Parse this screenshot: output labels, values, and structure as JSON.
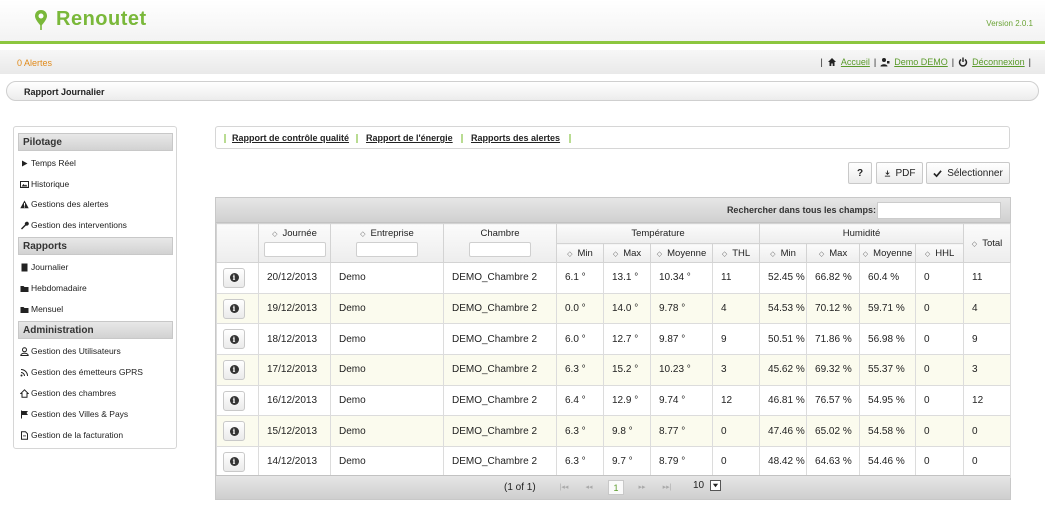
{
  "app": {
    "name": "Renoutet",
    "version": "Version 2.0.1"
  },
  "alerts": "0 Alertes",
  "topnav": {
    "home": "Accueil",
    "user": "Demo DEMO",
    "logout": "Déconnexion",
    "sep": "|"
  },
  "breadcrumb": "Rapport Journalier",
  "sidebar": {
    "sections": [
      {
        "title": "Pilotage",
        "items": [
          {
            "label": "Temps Réel",
            "icon": "play-icon"
          },
          {
            "label": "Historique",
            "icon": "image-icon"
          },
          {
            "label": "Gestions des alertes",
            "icon": "warning-icon"
          },
          {
            "label": "Gestion des interventions",
            "icon": "wrench-icon"
          }
        ]
      },
      {
        "title": "Rapports",
        "items": [
          {
            "label": "Journalier",
            "icon": "document-icon"
          },
          {
            "label": "Hebdomadaire",
            "icon": "folder-icon"
          },
          {
            "label": "Mensuel",
            "icon": "folder-icon"
          }
        ]
      },
      {
        "title": "Administration",
        "items": [
          {
            "label": "Gestion des Utilisateurs",
            "icon": "user-icon"
          },
          {
            "label": "Gestion des émetteurs GPRS",
            "icon": "signal-icon"
          },
          {
            "label": "Gestion des chambres",
            "icon": "home-icon"
          },
          {
            "label": "Gestion des Villes & Pays",
            "icon": "flag-icon"
          },
          {
            "label": "Gestion de la facturation",
            "icon": "bill-icon"
          }
        ]
      }
    ]
  },
  "tabs": [
    "Rapport de contrôle qualité",
    "Rapport de l'énergie",
    "Rapports des alertes"
  ],
  "buttons": {
    "help": "?",
    "pdf": "PDF",
    "select": "Sélectionner"
  },
  "search_label": "Rechercher dans tous les champs:",
  "table": {
    "headers": {
      "day": "Journée",
      "company": "Entreprise",
      "room": "Chambre",
      "temp": "Température",
      "hum": "Humidité",
      "total": "Total"
    },
    "subheaders": {
      "min": "Min",
      "max": "Max",
      "avg": "Moyenne",
      "thl": "THL",
      "hhl": "HHL"
    },
    "rows": [
      {
        "day": "20/12/2013",
        "company": "Demo",
        "room": "DEMO_Chambre 2",
        "tmin": "6.1 °",
        "tmax": "13.1 °",
        "tavg": "10.34 °",
        "thl": "11",
        "hmin": "52.45 %",
        "hmax": "66.82 %",
        "havg": "60.4 %",
        "hhl": "0",
        "total": "11"
      },
      {
        "day": "19/12/2013",
        "company": "Demo",
        "room": "DEMO_Chambre 2",
        "tmin": "0.0 °",
        "tmax": "14.0 °",
        "tavg": "9.78 °",
        "thl": "4",
        "hmin": "54.53 %",
        "hmax": "70.12 %",
        "havg": "59.71 %",
        "hhl": "0",
        "total": "4"
      },
      {
        "day": "18/12/2013",
        "company": "Demo",
        "room": "DEMO_Chambre 2",
        "tmin": "6.0 °",
        "tmax": "12.7 °",
        "tavg": "9.87 °",
        "thl": "9",
        "hmin": "50.51 %",
        "hmax": "71.86 %",
        "havg": "56.98 %",
        "hhl": "0",
        "total": "9"
      },
      {
        "day": "17/12/2013",
        "company": "Demo",
        "room": "DEMO_Chambre 2",
        "tmin": "6.3 °",
        "tmax": "15.2 °",
        "tavg": "10.23 °",
        "thl": "3",
        "hmin": "45.62 %",
        "hmax": "69.32 %",
        "havg": "55.37 %",
        "hhl": "0",
        "total": "3"
      },
      {
        "day": "16/12/2013",
        "company": "Demo",
        "room": "DEMO_Chambre 2",
        "tmin": "6.4 °",
        "tmax": "12.9 °",
        "tavg": "9.74 °",
        "thl": "12",
        "hmin": "46.81 %",
        "hmax": "76.57 %",
        "havg": "54.95 %",
        "hhl": "0",
        "total": "12"
      },
      {
        "day": "15/12/2013",
        "company": "Demo",
        "room": "DEMO_Chambre 2",
        "tmin": "6.3 °",
        "tmax": "9.8 °",
        "tavg": "8.77 °",
        "thl": "0",
        "hmin": "47.46 %",
        "hmax": "65.02 %",
        "havg": "54.58 %",
        "hhl": "0",
        "total": "0"
      },
      {
        "day": "14/12/2013",
        "company": "Demo",
        "room": "DEMO_Chambre 2",
        "tmin": "6.3 °",
        "tmax": "9.7 °",
        "tavg": "8.79 °",
        "thl": "0",
        "hmin": "48.42 %",
        "hmax": "64.63 %",
        "havg": "54.46 %",
        "hhl": "0",
        "total": "0"
      }
    ]
  },
  "pager": {
    "info": "(1 of 1)",
    "current": "1",
    "page_size": "10"
  },
  "colors": {
    "brand": "#7ab83a",
    "alert": "#e08a1a",
    "link": "#5a9a2a"
  }
}
